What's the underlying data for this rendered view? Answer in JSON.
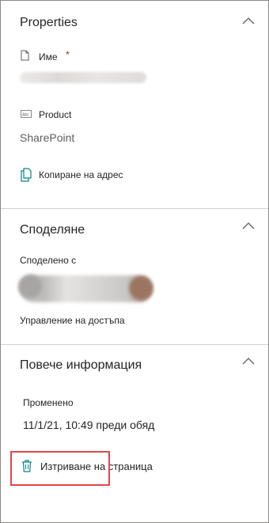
{
  "properties": {
    "title": "Properties",
    "name_label": "Име",
    "required_mark": "*",
    "product_label": "Product",
    "product_value": "SharePoint",
    "copy_address_label": "Копиране на адрес",
    "name_icon": "document-icon",
    "product_icon": "text-field-icon",
    "copy_icon": "copy-icon",
    "collapse_icon": "chevron-up-icon"
  },
  "sharing": {
    "title": "Споделяне",
    "shared_with_label": "Споделено с",
    "manage_access_label": "Управление на достъпа",
    "collapse_icon": "chevron-up-icon"
  },
  "more_info": {
    "title": "Повече информация",
    "modified_label": "Променено",
    "modified_value": "11/1/21, 10:49 преди обяд",
    "delete_label": "Изтриване на страница",
    "delete_icon": "trash-icon",
    "collapse_icon": "chevron-up-icon"
  },
  "colors": {
    "accent": "#038387",
    "highlight": "#e0474d",
    "required": "#a4262c",
    "divider": "#d2d0ce"
  }
}
